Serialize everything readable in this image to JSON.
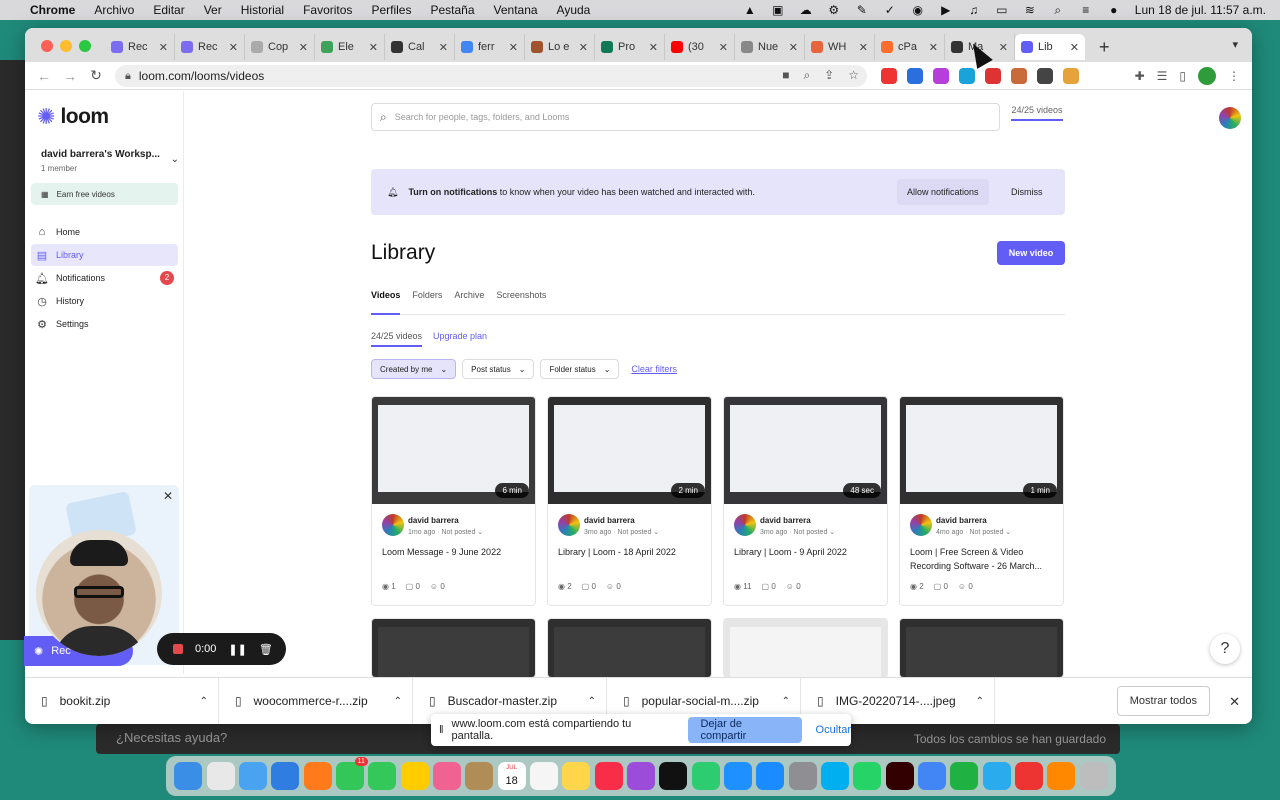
{
  "menubar": {
    "app": "Chrome",
    "items": [
      "Archivo",
      "Editar",
      "Ver",
      "Historial",
      "Favoritos",
      "Perfiles",
      "Pestaña",
      "Ventana",
      "Ayuda"
    ],
    "clock": "Lun 18 de jul.  11:57 a.m."
  },
  "browser": {
    "tabs": [
      {
        "label": "Rec",
        "color": "#7b6cf0"
      },
      {
        "label": "Rec",
        "color": "#7b6cf0"
      },
      {
        "label": "Cop",
        "color": "#aaaaaa"
      },
      {
        "label": "Ele",
        "color": "#3da35a"
      },
      {
        "label": "Cal",
        "color": "#333333"
      },
      {
        "label": "ferr",
        "color": "#4285f4"
      },
      {
        "label": "Lo e",
        "color": "#a0522d"
      },
      {
        "label": "Pro",
        "color": "#0f7a55"
      },
      {
        "label": "(30",
        "color": "#ff0000"
      },
      {
        "label": "Nue",
        "color": "#888888"
      },
      {
        "label": "WH",
        "color": "#e8643c"
      },
      {
        "label": "cPa",
        "color": "#ff6c2c"
      },
      {
        "label": "Ma",
        "color": "#333333"
      },
      {
        "label": "Lib",
        "color": "#625df5"
      }
    ],
    "active_tab_color": "#625df5",
    "url": "loom.com/looms/videos"
  },
  "loom": {
    "brand": "loom",
    "workspace_name": "david barrera's Worksp...",
    "workspace_members": "1 member",
    "earn": "Earn free videos",
    "nav": {
      "home": "Home",
      "library": "Library",
      "notifications": "Notifications",
      "notifications_count": "2",
      "history": "History",
      "settings": "Settings"
    },
    "search_placeholder": "Search for people, tags, folders, and Looms",
    "quota_top": "24/25 videos",
    "notice": {
      "bold": "Turn on notifications",
      "rest": "to know when your video has been watched and interacted with.",
      "allow": "Allow notifications",
      "dismiss": "Dismiss"
    },
    "title": "Library",
    "new_video": "New video",
    "tabs": {
      "videos": "Videos",
      "folders": "Folders",
      "archive": "Archive",
      "screenshots": "Screenshots"
    },
    "quota": "24/25 videos",
    "upgrade": "Upgrade plan",
    "filters": {
      "created": "Created by me",
      "post": "Post status",
      "folder": "Folder status",
      "clear": "Clear filters"
    },
    "videos": [
      {
        "author": "david barrera",
        "age": "1mo ago",
        "status": "Not posted",
        "title": "Loom Message - 9 June 2022",
        "duration": "6 min",
        "views": "1",
        "comments": "0",
        "reactions": "0"
      },
      {
        "author": "david barrera",
        "age": "3mo ago",
        "status": "Not posted",
        "title": "Library | Loom - 18 April 2022",
        "duration": "2 min",
        "views": "2",
        "comments": "0",
        "reactions": "0"
      },
      {
        "author": "david barrera",
        "age": "3mo ago",
        "status": "Not posted",
        "title": "Library | Loom - 9 April 2022",
        "duration": "48 sec",
        "views": "11",
        "comments": "0",
        "reactions": "0"
      },
      {
        "author": "david barrera",
        "age": "4mo ago",
        "status": "Not posted",
        "title": "Loom | Free Screen & Video Recording Software - 26 March...",
        "duration": "1 min",
        "views": "2",
        "comments": "0",
        "reactions": "0"
      }
    ]
  },
  "recorder": {
    "label": "Rec",
    "time": "0:00"
  },
  "downloads": {
    "files": [
      "bookit.zip",
      "woocommerce-r....zip",
      "Buscador-master.zip",
      "popular-social-m....zip",
      "IMG-20220714-....jpeg"
    ],
    "show_all": "Mostrar todos"
  },
  "sharing": {
    "text": "www.loom.com está compartiendo tu pantalla.",
    "stop": "Dejar de compartir",
    "hide": "Ocultar"
  },
  "background_app": {
    "help": "¿Necesitas ayuda?",
    "saved": "Todos los cambios se han guardado"
  },
  "dock_badge": "11",
  "dock_date": "18",
  "dock_month": "JUL",
  "help": "?"
}
